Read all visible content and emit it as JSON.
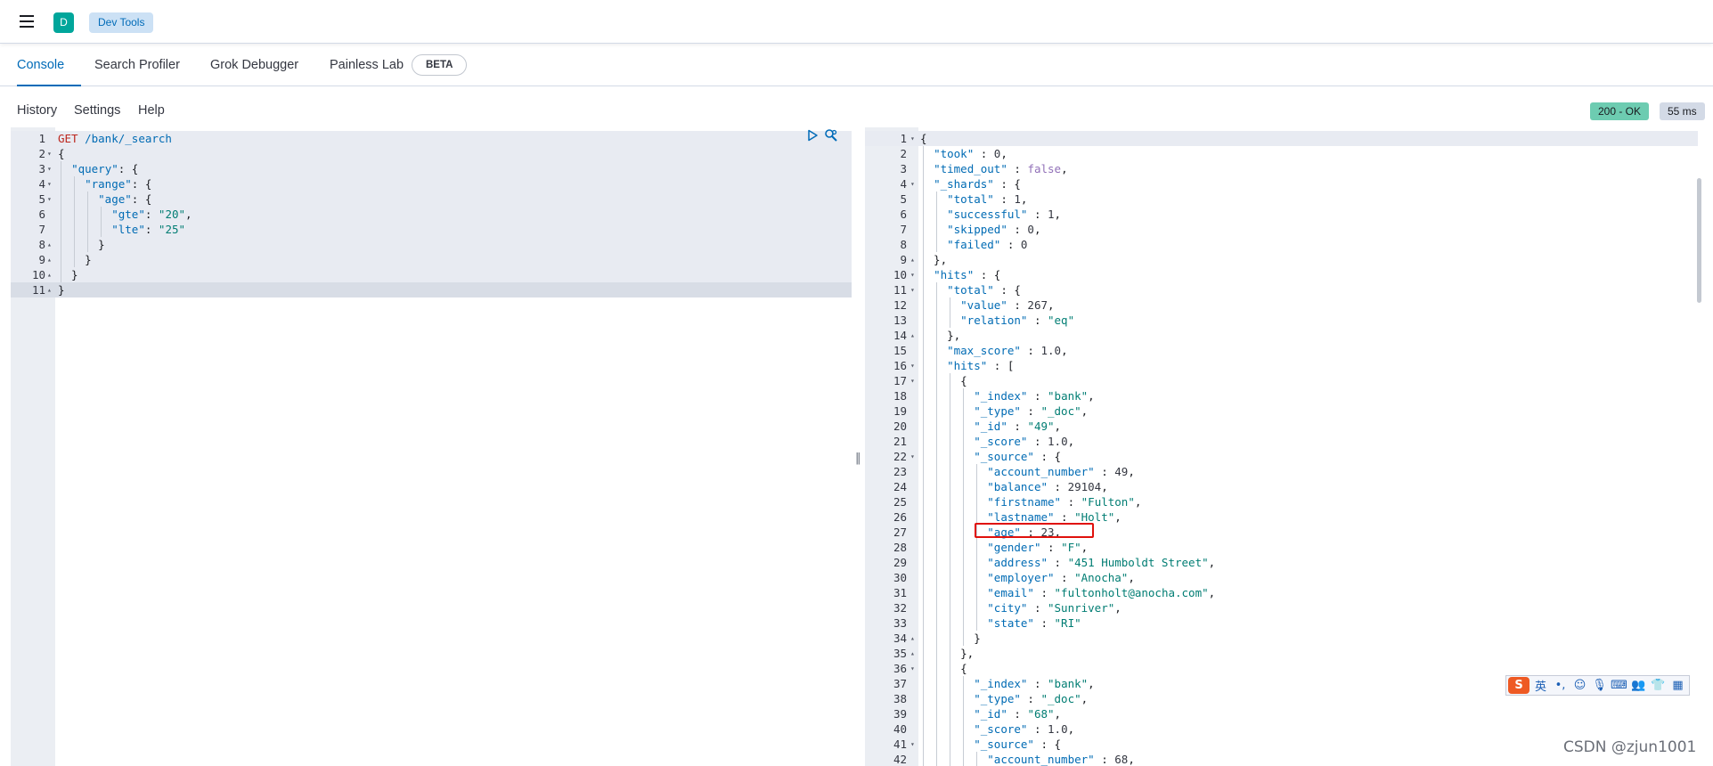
{
  "header": {
    "space_initial": "D",
    "breadcrumb": "Dev Tools"
  },
  "tabs": [
    {
      "label": "Console",
      "active": true
    },
    {
      "label": "Search Profiler",
      "active": false
    },
    {
      "label": "Grok Debugger",
      "active": false
    },
    {
      "label": "Painless Lab",
      "active": false
    }
  ],
  "beta_badge": "BETA",
  "toolbar": {
    "history": "History",
    "settings": "Settings",
    "help": "Help"
  },
  "response_status": {
    "status": "200 - OK",
    "status_color": "#6dccb1",
    "time": "55 ms"
  },
  "request": {
    "method": "GET",
    "path": "/bank/_search",
    "lines": [
      "GET /bank/_search",
      "{",
      "  \"query\": {",
      "    \"range\": {",
      "      \"age\": {",
      "        \"gte\": \"20\",",
      "        \"lte\": \"25\"",
      "      }",
      "    }",
      "  }",
      "}"
    ]
  },
  "response": {
    "lines": [
      "{",
      "  \"took\" : 0,",
      "  \"timed_out\" : false,",
      "  \"_shards\" : {",
      "    \"total\" : 1,",
      "    \"successful\" : 1,",
      "    \"skipped\" : 0,",
      "    \"failed\" : 0",
      "  },",
      "  \"hits\" : {",
      "    \"total\" : {",
      "      \"value\" : 267,",
      "      \"relation\" : \"eq\"",
      "    },",
      "    \"max_score\" : 1.0,",
      "    \"hits\" : [",
      "      {",
      "        \"_index\" : \"bank\",",
      "        \"_type\" : \"_doc\",",
      "        \"_id\" : \"49\",",
      "        \"_score\" : 1.0,",
      "        \"_source\" : {",
      "          \"account_number\" : 49,",
      "          \"balance\" : 29104,",
      "          \"firstname\" : \"Fulton\",",
      "          \"lastname\" : \"Holt\",",
      "          \"age\" : 23,",
      "          \"gender\" : \"F\",",
      "          \"address\" : \"451 Humboldt Street\",",
      "          \"employer\" : \"Anocha\",",
      "          \"email\" : \"fultonholt@anocha.com\",",
      "          \"city\" : \"Sunriver\",",
      "          \"state\" : \"RI\"",
      "        }",
      "      },",
      "      {",
      "        \"_index\" : \"bank\",",
      "        \"_type\" : \"_doc\",",
      "        \"_id\" : \"68\",",
      "        \"_score\" : 1.0,",
      "        \"_source\" : {",
      "          \"account_number\" : 68,"
    ]
  },
  "ime_toolbar": {
    "lang": "英",
    "punct": "•,",
    "icons": [
      "smiley-icon",
      "mic-icon",
      "keyboard-icon",
      "users-icon",
      "shirt-icon",
      "grid-icon"
    ]
  },
  "watermark": "CSDN @zjun1001"
}
